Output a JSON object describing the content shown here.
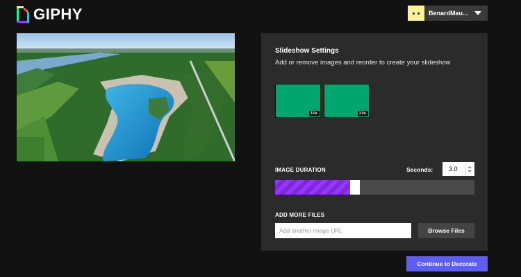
{
  "header": {
    "logo_text": "GIPHY",
    "logo_icon": "giphy-logo-icon",
    "username": "BenardMau...",
    "avatar_icon": "avatar-face-icon",
    "menu_icon": "chevron-down-icon"
  },
  "preview": {
    "image_icon": "aerial-quarry-lake-photo"
  },
  "slideshow": {
    "title": "Slideshow Settings",
    "subtitle": "Add or remove images and reorder to create your slideshow",
    "slides": [
      {
        "duration": "3.0s."
      },
      {
        "duration": "3.0s."
      }
    ],
    "slide_color": "#00a66e"
  },
  "duration": {
    "label": "IMAGE DURATION",
    "seconds_label": "Seconds:",
    "seconds_value": "3.0",
    "slider_fraction": 0.4,
    "slider_color": "#9933ff"
  },
  "add_files": {
    "label": "ADD MORE FILES",
    "url_placeholder": "Add another image URL",
    "url_value": "",
    "browse_label": "Browse Files"
  },
  "footer": {
    "continue_label": "Continue to Decorate",
    "continue_color": "#5e5ef5"
  }
}
